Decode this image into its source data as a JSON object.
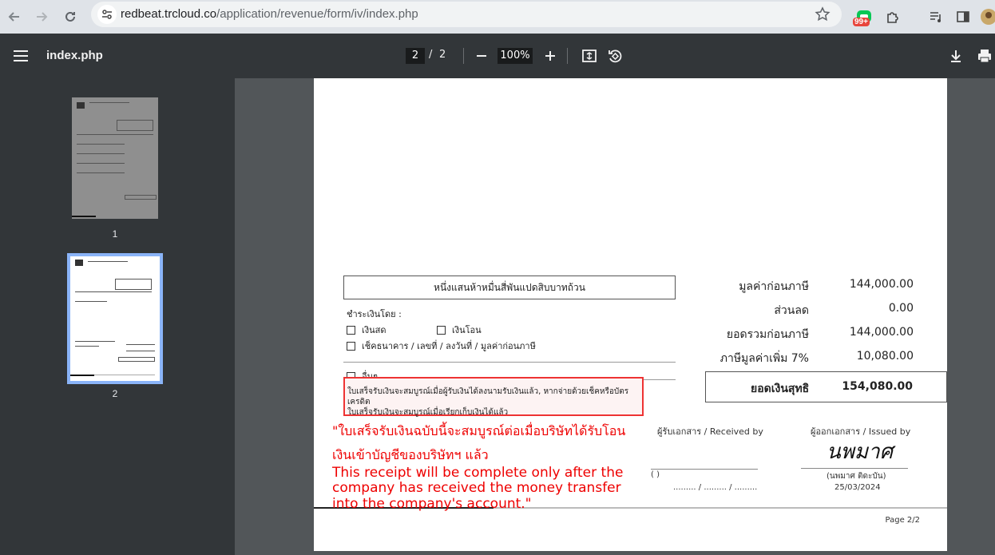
{
  "browser": {
    "url_host": "redbeat.trcloud.co",
    "url_path": "/application/revenue/form/iv/index.php",
    "badge": "99+"
  },
  "viewer": {
    "title": "index.php",
    "current_page": "2",
    "separator": "/",
    "total_pages": "2",
    "zoom": "100%",
    "thumbnails": [
      {
        "label": "1"
      },
      {
        "label": "2"
      }
    ]
  },
  "document": {
    "amount_in_words": "หนึ่งแสนห้าหมื่นสี่พันแปดสิบบาทถ้วน",
    "payment_by": "ชำระเงินโดย :",
    "payment_options": {
      "cash": "เงินสด",
      "transfer": "เงินโอน",
      "cheque": "เช็คธนาคาร / เลขที่ / ลงวันที่ / มูลค่าก่อนภาษี",
      "other": "อื่นๆ"
    },
    "receipt_note_line1": "ใบเสร็จรับเงินจะสมบูรณ์เมื่อผู้รับเงินได้ลงนามรับเงินแล้ว, หากจ่ายด้วยเช็คหรือบัตรเครดิต",
    "receipt_note_line2": "ใบเสร็จรับเงินจะสมบูรณ์เมื่อเรียกเก็บเงินได้แล้ว",
    "summary": [
      {
        "label": "มูลค่าก่อนภาษี",
        "value": "144,000.00"
      },
      {
        "label": "ส่วนลด",
        "value": "0.00"
      },
      {
        "label": "ยอดรวมก่อนภาษี",
        "value": "144,000.00"
      },
      {
        "label": "ภาษีมูลค่าเพิ่ม 7%",
        "value": "10,080.00"
      }
    ],
    "net_label": "ยอดเงินสุทธิ",
    "net_value": "154,080.00",
    "received_by": "ผู้รับเอกสาร / Received by",
    "issued_by": "ผู้ออกเอกสาร / Issued by",
    "receiver_paren": "(                                                  )",
    "receiver_date": "......... / ......... / .........",
    "issuer_signature": "นพมาศ",
    "issuer_name": "(นพมาศ  ติดะบัน)",
    "issue_date": "25/03/2024",
    "page_footer": "Page 2/2"
  },
  "annotation": {
    "thai_line1": "\"ใบเสร็จรับเงินฉบับนี้จะสมบูรณ์ต่อเมื่อบริษัทได้รับโอน",
    "thai_line2": "เงินเข้าบัญชีของบริษัทฯ แล้ว",
    "en_line1": "This receipt will be complete only after the",
    "en_line2": "company has received the money transfer",
    "en_line3": "into the company's account.\""
  }
}
